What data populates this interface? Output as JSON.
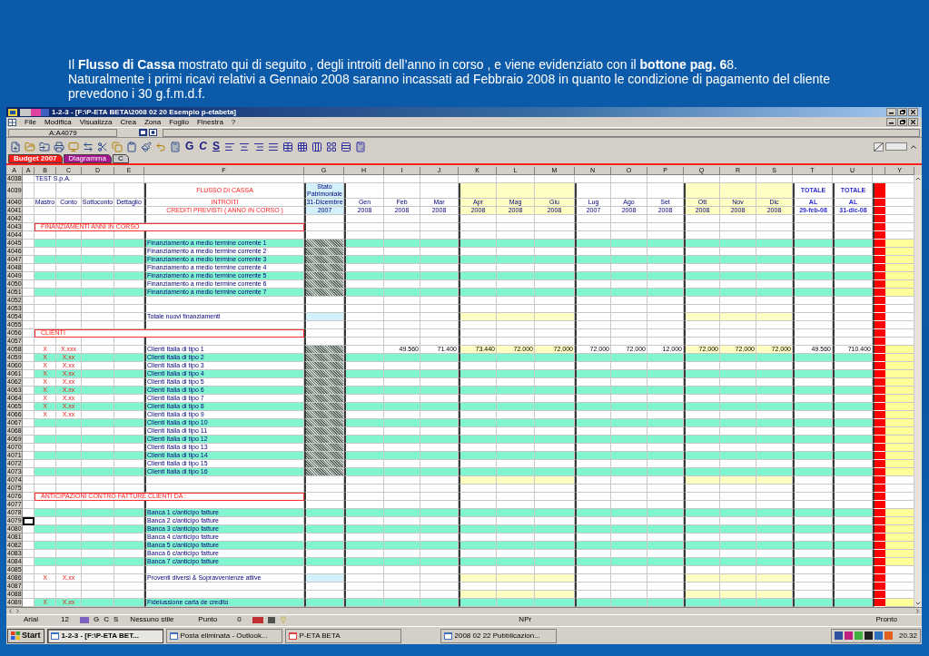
{
  "slide": {
    "caption": [
      "Il **Flusso di Cassa**  mostrato qui di seguito , degli introiti dell’anno in corso , e viene evidenziato con il **bottone pag. 6**8.",
      "Naturalmente i primi ricavi relativi a Gennaio 2008 saranno incassati ad Febbraio  2008 in quanto le condizione di pagamento del cliente prevedono i 30 g.f.m.d.f."
    ]
  },
  "window": {
    "title": "1-2-3 - [F:\\P-ETA BETA\\2008 02 20  Esempio p-etabeta]"
  },
  "menu": [
    "File",
    "Modifica",
    "Visualizza",
    "Crea",
    "Zona",
    "Foglio",
    "Finestra",
    "?"
  ],
  "address": "A:A4079",
  "format_buttons": [
    "G",
    "C",
    "S"
  ],
  "sheet_tabs": [
    {
      "label": "Budget 2007",
      "selected": true,
      "color": "#ff1a1a"
    },
    {
      "label": "Diagramma",
      "selected": false,
      "color": "#a3168e"
    },
    {
      "label": "C",
      "selected": false,
      "color": "#c8c8c8"
    }
  ],
  "sheet": {
    "letter": "A",
    "columns": [
      "A",
      "B",
      "C",
      "D",
      "E",
      "F",
      "G",
      "H",
      "I",
      "J",
      "K",
      "L",
      "M",
      "N",
      "O",
      "P",
      "Q",
      "R",
      "S",
      "T",
      "U"
    ],
    "extra_column": "Y",
    "rows": [
      {
        "n": "4038",
        "kind": "company",
        "shaded": false,
        "yellow": false,
        "hatched": false,
        "balance_highlight": false,
        "selected": false,
        "text": "TEST S.p.A."
      },
      {
        "n": "4039",
        "kind": "title",
        "shaded": false,
        "yellow": true,
        "hatched": false,
        "balance_highlight": true,
        "selected": false,
        "text": "FLUSSO DI CASSA",
        "balance": [
          "Stato",
          "Patrimoniale"
        ],
        "totals": [
          "TOTALE",
          "TOTALE"
        ]
      },
      {
        "n": "4040",
        "kind": "labels",
        "shaded": false,
        "yellow": true,
        "hatched": false,
        "balance_highlight": true,
        "selected": false,
        "dims": [
          "Mastro",
          "Conto",
          "Sottoconto",
          "Dettaglio"
        ],
        "text": "INTROITI",
        "balance": [
          "31-Dicembre"
        ],
        "values": [
          "Gen",
          "Feb",
          "Mar",
          "Apr",
          "Mag",
          "Giu",
          "Lug",
          "Ago",
          "Set",
          "Ott",
          "Nov",
          "Dic",
          "AL",
          "AL"
        ]
      },
      {
        "n": "4041",
        "kind": "years",
        "shaded": false,
        "yellow": true,
        "hatched": false,
        "balance_highlight": true,
        "selected": false,
        "text": "CREDITI PREVISTI  ( ANNO IN CORSO )",
        "balance": [
          "2007"
        ],
        "values": [
          "2008",
          "2008",
          "2008",
          "2008",
          "2008",
          "2008",
          "2007",
          "2008",
          "2008",
          "2008",
          "2008",
          "2008",
          "29-feb-08",
          "31-dic-08"
        ]
      },
      {
        "n": "4042",
        "kind": "blank",
        "shaded": false,
        "yellow": false,
        "hatched": false,
        "balance_highlight": false,
        "selected": false
      },
      {
        "n": "4043",
        "kind": "section",
        "shaded": false,
        "yellow": false,
        "hatched": false,
        "balance_highlight": false,
        "selected": false,
        "text": "FINANZIAMENTI ANNI IN CORSO"
      },
      {
        "n": "4044",
        "kind": "blank",
        "shaded": false,
        "yellow": false,
        "hatched": false,
        "balance_highlight": false,
        "selected": false
      },
      {
        "n": "4045",
        "kind": "item",
        "shaded": true,
        "yellow": false,
        "hatched": true,
        "balance_highlight": false,
        "selected": false,
        "text": "Finanziamento a medio termine corrente  1"
      },
      {
        "n": "4046",
        "kind": "item",
        "shaded": false,
        "yellow": false,
        "hatched": true,
        "balance_highlight": false,
        "selected": false,
        "text": "Finanziamento a medio termine corrente  2"
      },
      {
        "n": "4047",
        "kind": "item",
        "shaded": true,
        "yellow": false,
        "hatched": true,
        "balance_highlight": false,
        "selected": false,
        "text": "Finanziamento a medio termine corrente  3"
      },
      {
        "n": "4048",
        "kind": "item",
        "shaded": false,
        "yellow": false,
        "hatched": true,
        "balance_highlight": false,
        "selected": false,
        "text": "Finanziamento a medio termine corrente  4"
      },
      {
        "n": "4049",
        "kind": "item",
        "shaded": true,
        "yellow": false,
        "hatched": true,
        "balance_highlight": false,
        "selected": false,
        "text": "Finanziamento a medio termine corrente  5"
      },
      {
        "n": "4050",
        "kind": "item",
        "shaded": false,
        "yellow": false,
        "hatched": true,
        "balance_highlight": false,
        "selected": false,
        "text": "Finanziamento a medio termine corrente  6"
      },
      {
        "n": "4051",
        "kind": "item",
        "shaded": true,
        "yellow": false,
        "hatched": true,
        "balance_highlight": false,
        "selected": false,
        "text": "Finanziamento a medio termine corrente  7"
      },
      {
        "n": "4052",
        "kind": "blank",
        "shaded": false,
        "yellow": false,
        "hatched": false,
        "balance_highlight": false,
        "selected": false
      },
      {
        "n": "4053",
        "kind": "blank",
        "shaded": false,
        "yellow": false,
        "hatched": false,
        "balance_highlight": false,
        "selected": false
      },
      {
        "n": "4054",
        "kind": "total",
        "shaded": false,
        "yellow": true,
        "hatched": false,
        "balance_highlight": true,
        "selected": false,
        "text": "Totale nuovi finanziamenti"
      },
      {
        "n": "4055",
        "kind": "blank",
        "shaded": false,
        "yellow": false,
        "hatched": false,
        "balance_highlight": false,
        "selected": false
      },
      {
        "n": "4056",
        "kind": "section",
        "shaded": false,
        "yellow": false,
        "hatched": false,
        "balance_highlight": false,
        "selected": false,
        "text": "CLIENTI"
      },
      {
        "n": "4057",
        "kind": "blank",
        "shaded": false,
        "yellow": false,
        "hatched": false,
        "balance_highlight": false,
        "selected": false
      },
      {
        "n": "4058",
        "kind": "item",
        "shaded": false,
        "yellow": true,
        "hatched": true,
        "balance_highlight": false,
        "selected": false,
        "mastro": "X",
        "conto": "X.xxx",
        "text": "Clienti Italia di tipo 1",
        "values": [
          "49.560",
          "71.400",
          "73.440",
          "72.000",
          "72.000",
          "72.000",
          "72.000",
          "12.000",
          "72.000",
          "72.000",
          "72.000",
          "49.560",
          "710.400"
        ]
      },
      {
        "n": "4059",
        "kind": "item",
        "shaded": true,
        "yellow": false,
        "hatched": true,
        "balance_highlight": false,
        "selected": false,
        "mastro": "X",
        "conto": "X.xx",
        "text": "Clienti Italia di tipo 2"
      },
      {
        "n": "4060",
        "kind": "item",
        "shaded": false,
        "yellow": false,
        "hatched": true,
        "balance_highlight": false,
        "selected": false,
        "mastro": "X",
        "conto": "X.xx",
        "text": "Clienti Italia di tipo 3"
      },
      {
        "n": "4061",
        "kind": "item",
        "shaded": true,
        "yellow": false,
        "hatched": true,
        "balance_highlight": false,
        "selected": false,
        "mastro": "X",
        "conto": "X.xx",
        "text": "Clienti Italia di tipo 4"
      },
      {
        "n": "4062",
        "kind": "item",
        "shaded": false,
        "yellow": false,
        "hatched": true,
        "balance_highlight": false,
        "selected": false,
        "mastro": "X",
        "conto": "X.xx",
        "text": "Clienti Italia di tipo 5"
      },
      {
        "n": "4063",
        "kind": "item",
        "shaded": true,
        "yellow": false,
        "hatched": true,
        "balance_highlight": false,
        "selected": false,
        "mastro": "X",
        "conto": "X.xx",
        "text": "Clienti Italia di tipo 6"
      },
      {
        "n": "4064",
        "kind": "item",
        "shaded": false,
        "yellow": false,
        "hatched": true,
        "balance_highlight": false,
        "selected": false,
        "mastro": "X",
        "conto": "X.xx",
        "text": "Clienti Italia di tipo 7"
      },
      {
        "n": "4065",
        "kind": "item",
        "shaded": true,
        "yellow": false,
        "hatched": true,
        "balance_highlight": false,
        "selected": false,
        "mastro": "X",
        "conto": "X.xx",
        "text": "Clienti Italia di tipo 8"
      },
      {
        "n": "4066",
        "kind": "item",
        "shaded": false,
        "yellow": false,
        "hatched": true,
        "balance_highlight": false,
        "selected": false,
        "mastro": "X",
        "conto": "X.xx",
        "text": "Clienti Italia di tipo 9"
      },
      {
        "n": "4067",
        "kind": "item",
        "shaded": true,
        "yellow": false,
        "hatched": true,
        "balance_highlight": false,
        "selected": false,
        "text": "Clienti Italia di tipo 10"
      },
      {
        "n": "4068",
        "kind": "item",
        "shaded": false,
        "yellow": false,
        "hatched": true,
        "balance_highlight": false,
        "selected": false,
        "text": "Clienti Italia di tipo 11"
      },
      {
        "n": "4069",
        "kind": "item",
        "shaded": true,
        "yellow": false,
        "hatched": true,
        "balance_highlight": false,
        "selected": false,
        "text": "Clienti Italia di tipo 12"
      },
      {
        "n": "4070",
        "kind": "item",
        "shaded": false,
        "yellow": false,
        "hatched": true,
        "balance_highlight": false,
        "selected": false,
        "text": "Clienti Italia di tipo 13"
      },
      {
        "n": "4071",
        "kind": "item",
        "shaded": true,
        "yellow": false,
        "hatched": true,
        "balance_highlight": false,
        "selected": false,
        "text": "Clienti Italia di tipo 14"
      },
      {
        "n": "4072",
        "kind": "item",
        "shaded": false,
        "yellow": false,
        "hatched": true,
        "balance_highlight": false,
        "selected": false,
        "text": "Clienti Italia di tipo 15"
      },
      {
        "n": "4073",
        "kind": "item",
        "shaded": true,
        "yellow": false,
        "hatched": true,
        "balance_highlight": false,
        "selected": false,
        "text": "Clienti Italia di tipo 16"
      },
      {
        "n": "4074",
        "kind": "blank",
        "shaded": false,
        "yellow": true,
        "hatched": false,
        "balance_highlight": false,
        "selected": false
      },
      {
        "n": "4075",
        "kind": "blank",
        "shaded": false,
        "yellow": false,
        "hatched": false,
        "balance_highlight": false,
        "selected": false
      },
      {
        "n": "4076",
        "kind": "section",
        "shaded": false,
        "yellow": false,
        "hatched": false,
        "balance_highlight": false,
        "selected": false,
        "text": "ANTICIPAZIONI CONTRO FATTURE CLIENTI DA :"
      },
      {
        "n": "4077",
        "kind": "blank",
        "shaded": false,
        "yellow": false,
        "hatched": false,
        "balance_highlight": false,
        "selected": false
      },
      {
        "n": "4078",
        "kind": "item",
        "shaded": true,
        "yellow": false,
        "hatched": false,
        "balance_highlight": false,
        "selected": false,
        "text": "Banca 1 c/anticipo fatture"
      },
      {
        "n": "4079",
        "kind": "item",
        "shaded": false,
        "yellow": false,
        "hatched": false,
        "balance_highlight": false,
        "selected": true,
        "text": "Banca 2 c/anticipo fatture"
      },
      {
        "n": "4080",
        "kind": "item",
        "shaded": true,
        "yellow": false,
        "hatched": false,
        "balance_highlight": false,
        "selected": false,
        "text": "Banca 3 c/anticipo fatture"
      },
      {
        "n": "4081",
        "kind": "item",
        "shaded": false,
        "yellow": false,
        "hatched": false,
        "balance_highlight": false,
        "selected": false,
        "text": "Banca 4 c/anticipo fatture"
      },
      {
        "n": "4082",
        "kind": "item",
        "shaded": true,
        "yellow": false,
        "hatched": false,
        "balance_highlight": false,
        "selected": false,
        "text": "Banca 5 c/anticipo fatture"
      },
      {
        "n": "4083",
        "kind": "item",
        "shaded": false,
        "yellow": false,
        "hatched": false,
        "balance_highlight": false,
        "selected": false,
        "text": "Banca 6 c/anticipo fatture"
      },
      {
        "n": "4084",
        "kind": "item",
        "shaded": true,
        "yellow": false,
        "hatched": false,
        "balance_highlight": false,
        "selected": false,
        "text": "Banca 7 c/anticipo fatture"
      },
      {
        "n": "4085",
        "kind": "blank",
        "shaded": false,
        "yellow": false,
        "hatched": false,
        "balance_highlight": false,
        "selected": false
      },
      {
        "n": "4086",
        "kind": "total",
        "shaded": false,
        "yellow": true,
        "hatched": false,
        "balance_highlight": true,
        "selected": false,
        "mastro": "X",
        "conto": "X.xx",
        "text": "Proventi diversi & Sopravvenienze attive"
      },
      {
        "n": "4087",
        "kind": "blank",
        "shaded": false,
        "yellow": false,
        "hatched": false,
        "balance_highlight": false,
        "selected": false
      },
      {
        "n": "4088",
        "kind": "blank",
        "shaded": false,
        "yellow": true,
        "hatched": false,
        "balance_highlight": false,
        "selected": false
      },
      {
        "n": "4089",
        "kind": "item",
        "shaded": true,
        "yellow": false,
        "hatched": false,
        "balance_highlight": false,
        "selected": false,
        "mastro": "X",
        "conto": "X.xx",
        "text": "Fideiussione carta de credito"
      }
    ]
  },
  "status_bar": {
    "font": "Arial",
    "size": "12",
    "format_buttons": [
      "G",
      "C",
      "S"
    ],
    "style": "Nessuno stile",
    "format": "Punto",
    "decimals": "0",
    "mode": "NPr",
    "state": "Pronto"
  },
  "taskbar": {
    "start": "Start",
    "tasks": [
      {
        "label": "1-2-3 - [F:\\P-ETA BET...",
        "selected": true
      },
      {
        "label": "Posta eliminata - Outlook...",
        "selected": false
      },
      {
        "label": "P-ETA BETA",
        "selected": false
      },
      {
        "label": "2008 02 22 Pubblicazion...",
        "selected": false
      }
    ],
    "clock": "20.32"
  }
}
